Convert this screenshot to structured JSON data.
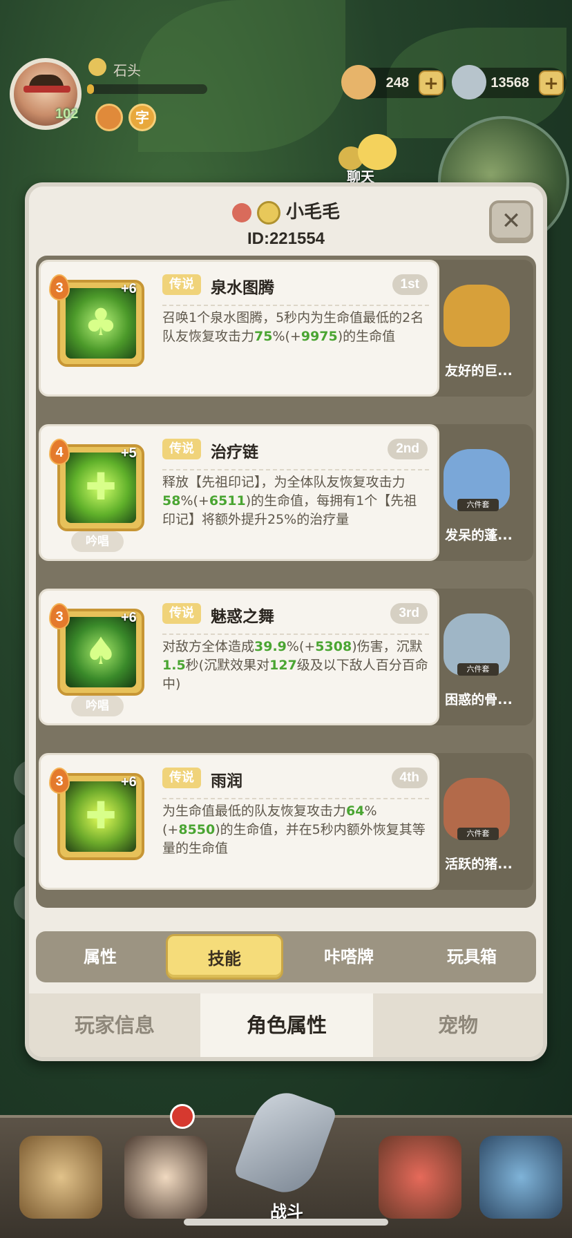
{
  "hud": {
    "player_name": "石头",
    "level": "102",
    "xp_fraction": 0.06,
    "badge_b_glyph": "字",
    "currency_a": "248",
    "currency_b": "13568",
    "plus": "+",
    "chat_label": "聊天"
  },
  "modal": {
    "owner_name": "小毛毛",
    "owner_id": "ID:221554",
    "close_glyph": "✕"
  },
  "skills": [
    {
      "level": "3",
      "plus": "+6",
      "rarity": "传说",
      "name": "泉水图腾",
      "rank": "1st",
      "desc_parts": [
        "召唤1个泉水图腾，5秒内为生命值最低的2名队友恢复攻击力",
        "75",
        "%(+",
        "9975",
        ")的生命值"
      ],
      "chant": "",
      "toy": {
        "name": "友好的巨...",
        "tag": "",
        "color": "#d7a03a"
      }
    },
    {
      "level": "4",
      "plus": "+5",
      "rarity": "传说",
      "name": "治疗链",
      "rank": "2nd",
      "desc_parts": [
        "释放【先祖印记】，为全体队友恢复攻击力",
        "58",
        "%(+",
        "6511",
        ")的生命值，每拥有1个【先祖印记】将额外提升25%的治疗量"
      ],
      "chant": "吟唱",
      "toy": {
        "name": "发呆的蓬...",
        "tag": "六件套",
        "color": "#7aa7d8"
      }
    },
    {
      "level": "3",
      "plus": "+6",
      "rarity": "传说",
      "name": "魅惑之舞",
      "rank": "3rd",
      "desc_parts": [
        "对敌方全体造成",
        "39.9",
        "%(+",
        "5308",
        ")伤害，沉默",
        "1.5",
        "秒(沉默效果对",
        "127",
        "级及以下敌人百分百命中)"
      ],
      "chant": "吟唱",
      "toy": {
        "name": "困惑的骨...",
        "tag": "六件套",
        "color": "#9fb6c6"
      }
    },
    {
      "level": "3",
      "plus": "+6",
      "rarity": "传说",
      "name": "雨润",
      "rank": "4th",
      "desc_parts": [
        "为生命值最低的队友恢复攻击力",
        "64",
        "%(+",
        "8550",
        ")的生命值，并在5秒内额外恢复其等量的生命值"
      ],
      "chant": "",
      "toy": {
        "name": "活跃的猪...",
        "tag": "六件套",
        "color": "#b36a4a"
      }
    }
  ],
  "subtabs": [
    "属性",
    "技能",
    "咔嗒牌",
    "玩具箱"
  ],
  "maintabs": [
    "玩家信息",
    "角色属性",
    "宠物"
  ],
  "bottom_nav": {
    "fight_label": "战斗"
  },
  "colors": {
    "highlight_green": "#4aa532",
    "active_tab": "#f5dc7a"
  }
}
